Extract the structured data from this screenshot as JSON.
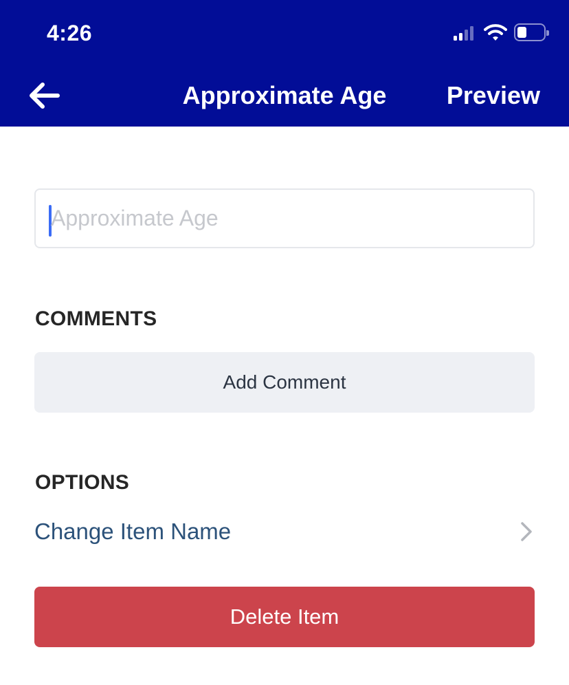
{
  "status_bar": {
    "time": "4:26",
    "signal_icon": "cellular-signal-icon",
    "wifi_icon": "wifi-icon",
    "battery_icon": "battery-icon",
    "battery_level": 0.35
  },
  "nav": {
    "back_icon": "arrow-left-icon",
    "title": "Approximate Age",
    "preview_label": "Preview"
  },
  "item_name_input": {
    "value": "",
    "placeholder": "Approximate Age"
  },
  "comments": {
    "heading": "COMMENTS",
    "add_comment_label": "Add Comment"
  },
  "options": {
    "heading": "OPTIONS",
    "change_name_label": "Change Item Name",
    "chevron_icon": "chevron-right-icon"
  },
  "delete_label": "Delete Item",
  "colors": {
    "header_bg": "#020d97",
    "delete_bg": "#cc444c",
    "link_text": "#2c527a",
    "comment_btn_bg": "#eef0f4",
    "caret": "#3b6cf5"
  }
}
